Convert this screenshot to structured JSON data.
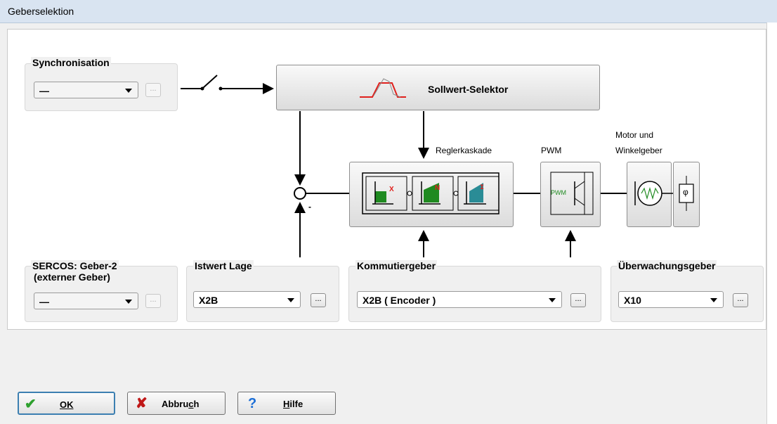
{
  "window": {
    "title": "Geberselektion"
  },
  "synchronisation": {
    "label": "Synchronisation",
    "value": "—",
    "more": "..."
  },
  "sollwert": {
    "label": "Sollwert-Selektor"
  },
  "diagram": {
    "reglerkaskade": "Reglerkaskade",
    "pwm": "PWM",
    "pwm_symbol": "PWM",
    "motor_line1": "Motor und",
    "motor_line2": "Winkelgeber",
    "minus": "-",
    "x_sub": "X",
    "n_sub": "N",
    "i_sub": "I",
    "phi": "φ"
  },
  "sercos": {
    "label_line1": "SERCOS: Geber-2",
    "label_line2": "(externer Geber)",
    "value": "—",
    "more": "..."
  },
  "istwert": {
    "label": "Istwert Lage",
    "value": "X2B",
    "more": "..."
  },
  "kommutier": {
    "label": "Kommutiergeber",
    "value": "X2B ( Encoder )",
    "more": "..."
  },
  "ueberwachung": {
    "label": "Überwachungsgeber",
    "value": "X10",
    "more": "..."
  },
  "buttons": {
    "ok_label": "OK",
    "cancel_pre": "Abbru",
    "cancel_key": "c",
    "cancel_post": "h",
    "help_key": "H",
    "help_rest": "ilfe"
  },
  "colors": {
    "red": "#e0201c",
    "green": "#1f8a20",
    "teal": "#2a8c96"
  }
}
